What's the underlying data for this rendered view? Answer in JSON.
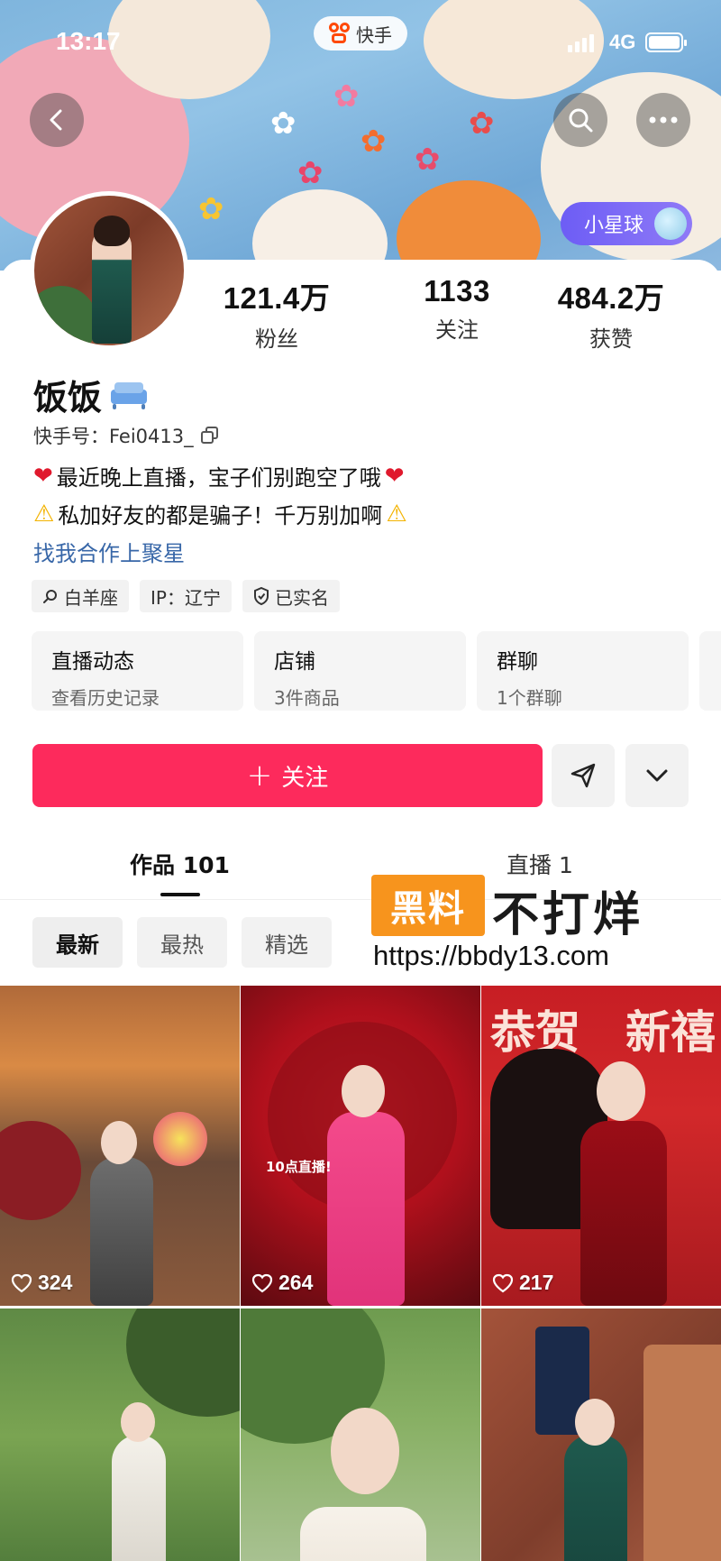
{
  "status_bar": {
    "time": "13:17",
    "app_name": "快手",
    "network": "4G"
  },
  "banner": {
    "planet_label": "小星球"
  },
  "profile": {
    "name": "饭饭",
    "name_emoji": "sofa-icon",
    "uid": "快手号：Fei0413_",
    "stats": [
      {
        "value": "121.4万",
        "label": "粉丝"
      },
      {
        "value": "1133",
        "label": "关注"
      },
      {
        "value": "484.2万",
        "label": "获赞"
      }
    ],
    "bio_line1": "最近晚上直播，宝子们别跑空了哦",
    "bio_line2": "私加好友的都是骗子！千万别加啊",
    "coop_link": "找我合作上聚星",
    "tags": [
      {
        "icon": "search-icon",
        "label": "白羊座"
      },
      {
        "icon": "",
        "label": "IP：辽宁"
      },
      {
        "icon": "shield-icon",
        "label": "已实名"
      }
    ],
    "features": [
      {
        "title": "直播动态",
        "sub": "查看历史记录"
      },
      {
        "title": "店铺",
        "sub": "3件商品"
      },
      {
        "title": "群聊",
        "sub": "1个群聊"
      }
    ]
  },
  "actions": {
    "follow_label": "关注"
  },
  "tabs": {
    "works": "作品 101",
    "live": "直播 1"
  },
  "watermark": {
    "box_text": "黑料",
    "text": "不打烊",
    "url": "https://bbdy13.com"
  },
  "filters": [
    "最新",
    "最热",
    "精选"
  ],
  "grid": [
    {
      "likes": "324",
      "caption": ""
    },
    {
      "likes": "264",
      "caption": "10点直播!"
    },
    {
      "likes": "217",
      "caption": ""
    },
    {
      "likes": "",
      "caption": ""
    },
    {
      "likes": "",
      "caption": ""
    },
    {
      "likes": "",
      "caption": ""
    }
  ],
  "grid_titles": {
    "left": "恭贺",
    "right": "新禧"
  },
  "colors": {
    "follow": "#fd2a5c",
    "link": "#3867a8",
    "planet": "#6d5df5",
    "watermark": "#f7941d"
  }
}
